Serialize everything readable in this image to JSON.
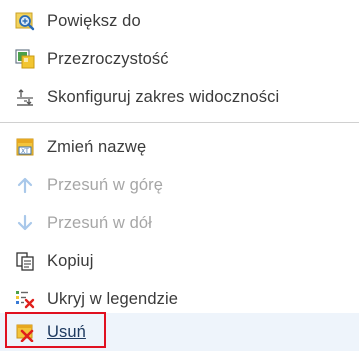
{
  "menu": {
    "items": [
      {
        "label": "Powiększ do",
        "icon": "zoom-to-icon",
        "disabled": false
      },
      {
        "label": "Przezroczystość",
        "icon": "transparency-icon",
        "disabled": false
      },
      {
        "label": "Skonfiguruj zakres widoczności",
        "icon": "visibility-range-icon",
        "disabled": false
      },
      {
        "label": "Zmień nazwę",
        "icon": "rename-icon",
        "disabled": false
      },
      {
        "label": "Przesuń w górę",
        "icon": "arrow-up-icon",
        "disabled": true
      },
      {
        "label": "Przesuń w dół",
        "icon": "arrow-down-icon",
        "disabled": true
      },
      {
        "label": "Kopiuj",
        "icon": "copy-icon",
        "disabled": false
      },
      {
        "label": "Ukryj w legendzie",
        "icon": "hide-in-legend-icon",
        "disabled": false
      },
      {
        "label": "Usuń",
        "icon": "remove-icon",
        "disabled": false,
        "hovered": true,
        "highlighted": true
      }
    ]
  },
  "colors": {
    "text": "#3b3b3b",
    "disabled_text": "#a6a6a6",
    "hover_background": "#eef4fb",
    "highlight_border": "#e01020",
    "separator": "#d0d0d0"
  }
}
